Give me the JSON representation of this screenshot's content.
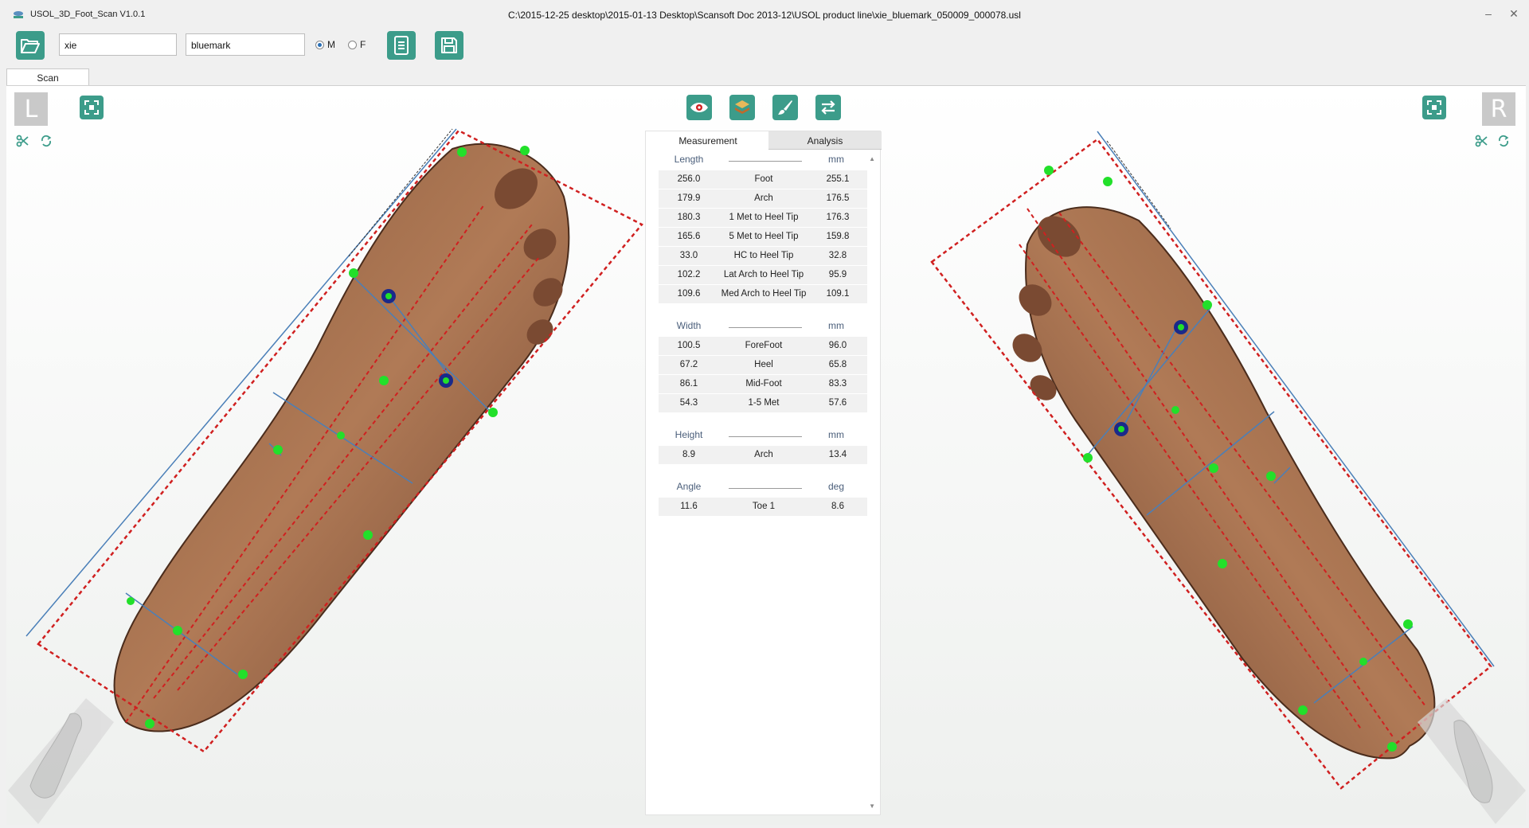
{
  "window": {
    "app_title": "USOL_3D_Foot_Scan V1.0.1",
    "file_path": "C:\\2015-12-25 desktop\\2015-01-13 Desktop\\Scansoft Doc 2013-12\\USOL product line\\xie_bluemark_050009_000078.usl",
    "minimize": "–",
    "close": "✕"
  },
  "toolbar": {
    "first_name": "xie",
    "last_name": "bluemark",
    "gender_m": "M",
    "gender_f": "F",
    "gender_selected": "M"
  },
  "tabs": [
    "Scan"
  ],
  "left_view": {
    "label": "L"
  },
  "right_view": {
    "label": "R"
  },
  "panel": {
    "tabs": [
      "Measurement",
      "Analysis"
    ],
    "active_tab": "Measurement",
    "sections": [
      {
        "title": "Length",
        "unit": "mm",
        "rows": [
          {
            "left": "256.0",
            "name": "Foot",
            "right": "255.1"
          },
          {
            "left": "179.9",
            "name": "Arch",
            "right": "176.5"
          },
          {
            "left": "180.3",
            "name": "1 Met to Heel Tip",
            "right": "176.3"
          },
          {
            "left": "165.6",
            "name": "5 Met to Heel Tip",
            "right": "159.8"
          },
          {
            "left": "33.0",
            "name": "HC to Heel Tip",
            "right": "32.8"
          },
          {
            "left": "102.2",
            "name": "Lat Arch to Heel Tip",
            "right": "95.9"
          },
          {
            "left": "109.6",
            "name": "Med Arch to Heel Tip",
            "right": "109.1"
          }
        ]
      },
      {
        "title": "Width",
        "unit": "mm",
        "rows": [
          {
            "left": "100.5",
            "name": "ForeFoot",
            "right": "96.0"
          },
          {
            "left": "67.2",
            "name": "Heel",
            "right": "65.8"
          },
          {
            "left": "86.1",
            "name": "Mid-Foot",
            "right": "83.3"
          },
          {
            "left": "54.3",
            "name": "1-5 Met",
            "right": "57.6"
          }
        ]
      },
      {
        "title": "Height",
        "unit": "mm",
        "rows": [
          {
            "left": "8.9",
            "name": "Arch",
            "right": "13.4"
          }
        ]
      },
      {
        "title": "Angle",
        "unit": "deg",
        "rows": [
          {
            "left": "11.6",
            "name": "Toe 1",
            "right": "8.6"
          }
        ]
      }
    ]
  },
  "colors": {
    "accent": "#3c9c8a",
    "guide_red": "#d02020",
    "landmark_green": "#22e02a",
    "axis_blue": "#4a7fb8"
  }
}
